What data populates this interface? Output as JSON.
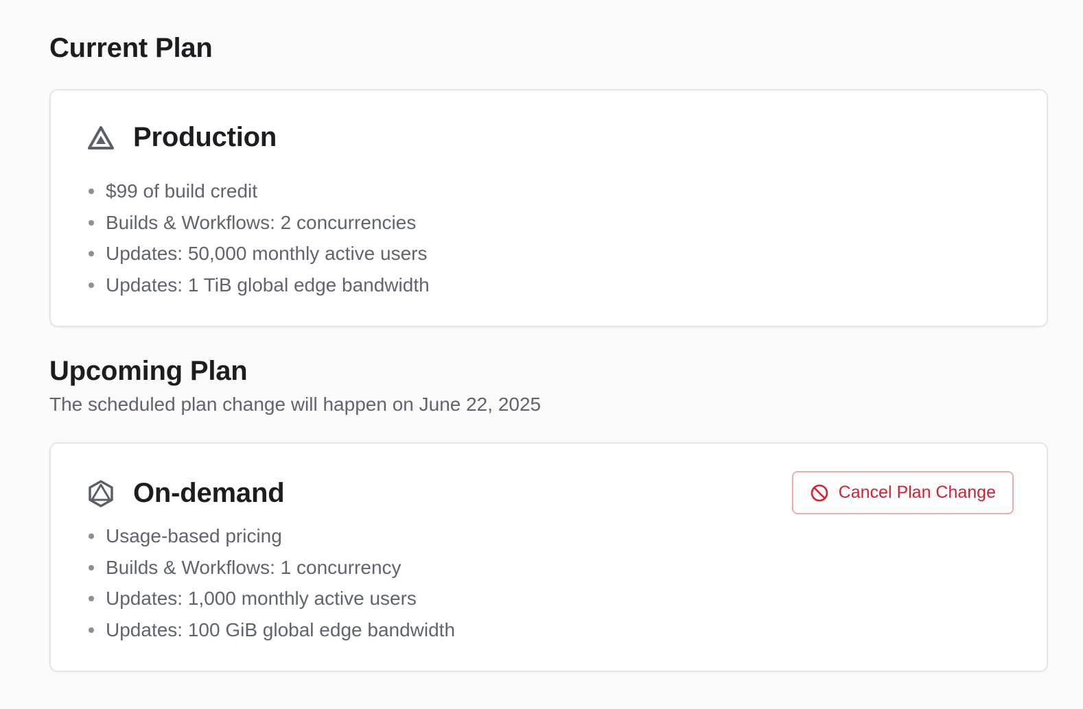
{
  "current": {
    "title": "Current Plan",
    "plan": {
      "icon": "triangle-plan-icon",
      "name": "Production",
      "features": [
        "$99 of build credit",
        "Builds & Workflows: 2 concurrencies",
        "Updates: 50,000 monthly active users",
        "Updates: 1 TiB global edge bandwidth"
      ]
    }
  },
  "upcoming": {
    "title": "Upcoming Plan",
    "subtitle": "The scheduled plan change will happen on June 22, 2025",
    "plan": {
      "icon": "hexagon-plan-icon",
      "name": "On-demand",
      "features": [
        "Usage-based pricing",
        "Builds & Workflows: 1 concurrency",
        "Updates: 1,000 monthly active users",
        "Updates: 100 GiB global edge bandwidth"
      ]
    },
    "cancel_button": {
      "label": "Cancel Plan Change",
      "icon": "cancel-circle-icon"
    }
  },
  "colors": {
    "background": "#fafafb",
    "heading": "#1b1d21",
    "body_text": "#5f6470",
    "danger": "#d8202e",
    "danger_border": "#f1a9ae",
    "card_border": "#e3e5e9"
  }
}
